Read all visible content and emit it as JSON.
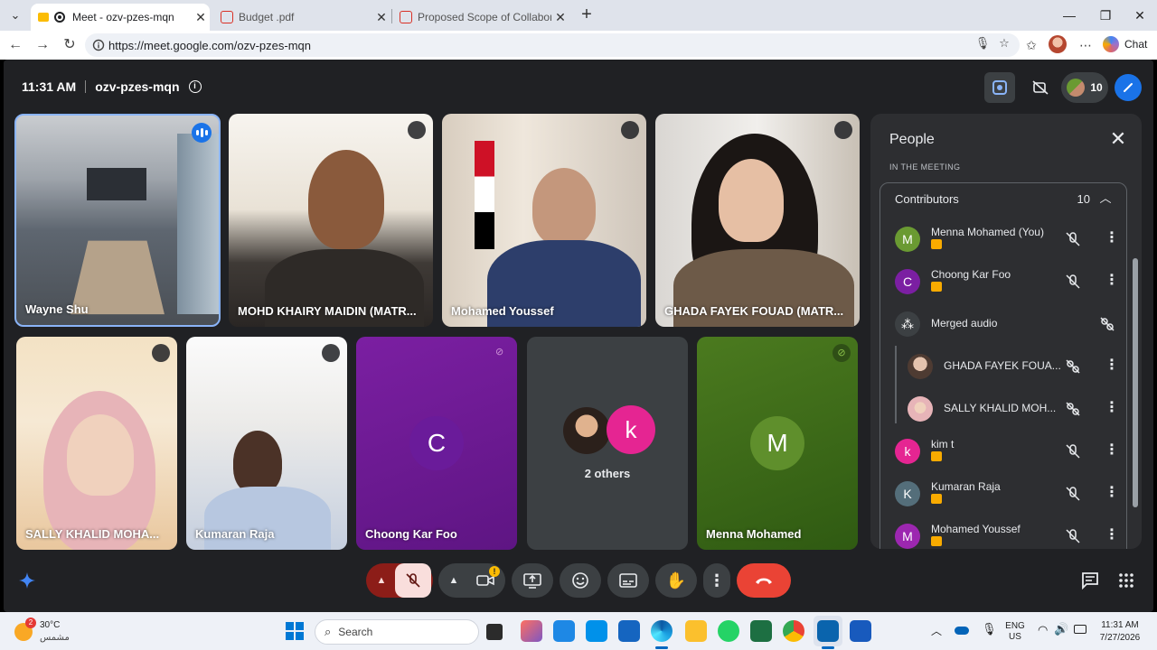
{
  "browser": {
    "tabs": [
      {
        "title": "Meet - ozv-pzes-mqn",
        "active": true
      },
      {
        "title": "Budget .pdf",
        "active": false
      },
      {
        "title": "Proposed Scope of Collaboration",
        "active": false
      }
    ],
    "url": "https://meet.google.com/ozv-pzes-mqn",
    "chat_label": "Chat"
  },
  "meeting": {
    "time": "11:31 AM",
    "code": "ozv-pzes-mqn",
    "participant_count": "10"
  },
  "tiles": [
    {
      "name": "Wayne Shu",
      "speaking": true
    },
    {
      "name": "MOHD KHAIRY MAIDIN (MATR..."
    },
    {
      "name": "Mohamed Youssef"
    },
    {
      "name": "GHADA FAYEK FOUAD (MATR..."
    },
    {
      "name": "SALLY KHALID MOHA..."
    },
    {
      "name": "Kumaran Raja"
    },
    {
      "name": "Choong Kar Foo",
      "initial": "C"
    },
    {
      "name": "2 others",
      "initial": "k"
    },
    {
      "name": "Menna Mohamed",
      "initial": "M"
    }
  ],
  "people_panel": {
    "title": "People",
    "section_label": "IN THE MEETING",
    "group_label": "Contributors",
    "group_count": "10",
    "rows": [
      {
        "name": "Menna Mohamed (You)",
        "initial": "M",
        "color": "#6a9a32"
      },
      {
        "name": "Choong Kar Foo",
        "initial": "C",
        "color": "#7b1fa2"
      },
      {
        "name": "Merged audio",
        "initial": "",
        "color": "#3c4043"
      },
      {
        "name": "GHADA FAYEK FOUA...",
        "initial": "",
        "color": "#8d6e63"
      },
      {
        "name": "SALLY KHALID MOH...",
        "initial": "",
        "color": "#c48b6e"
      },
      {
        "name": "kim t",
        "initial": "k",
        "color": "#e52592"
      },
      {
        "name": "Kumaran Raja",
        "initial": "K",
        "color": "#546e7a"
      },
      {
        "name": "Mohamed Youssef",
        "initial": "M",
        "color": "#9c27b0"
      }
    ]
  },
  "taskbar": {
    "weather_temp": "30°C",
    "weather_desc": "مشمس",
    "weather_badge": "2",
    "search_placeholder": "Search",
    "lang_top": "ENG",
    "lang_bottom": "US",
    "clock_time": "11:31 AM",
    "clock_date": "7/27/2026"
  },
  "colors": {
    "accent_blue": "#1a73e8",
    "meet_bg": "#202124",
    "end_call": "#ea4335",
    "mic_off_bg": "#f9dedc"
  }
}
